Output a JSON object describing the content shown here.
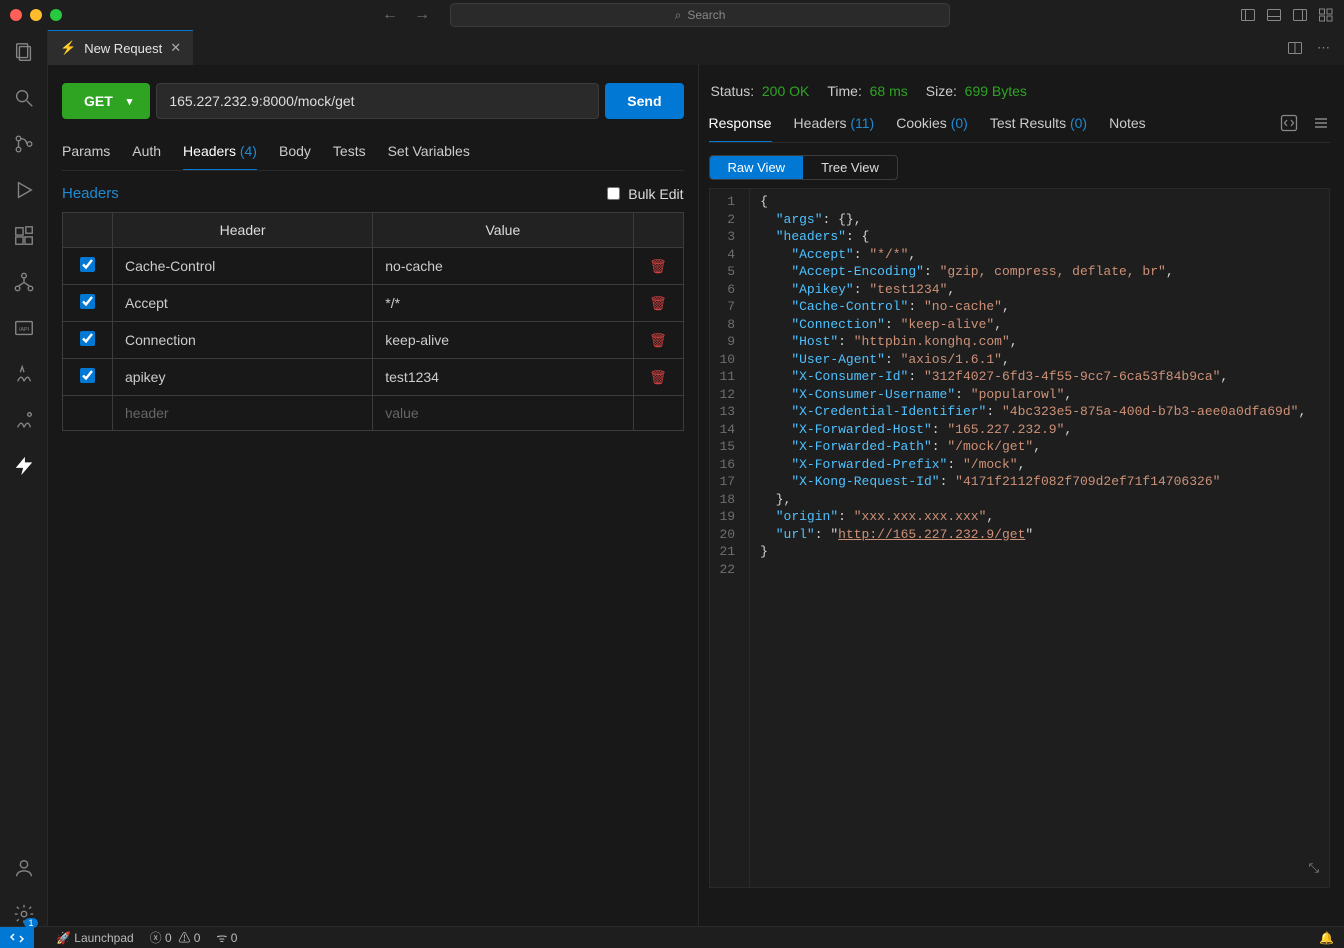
{
  "titlebar": {
    "search_placeholder": "Search"
  },
  "tab": {
    "title": "New Request"
  },
  "request": {
    "method": "GET",
    "url": "165.227.232.9:8000/mock/get",
    "send_label": "Send",
    "tabs": {
      "params": "Params",
      "auth": "Auth",
      "headers": "Headers",
      "headers_count": "(4)",
      "body": "Body",
      "tests": "Tests",
      "setvars": "Set Variables"
    },
    "section_title": "Headers",
    "bulk_label": "Bulk Edit",
    "table": {
      "col_header": "Header",
      "col_value": "Value",
      "rows": [
        {
          "checked": true,
          "header": "Cache-Control",
          "value": "no-cache"
        },
        {
          "checked": true,
          "header": "Accept",
          "value": "*/*"
        },
        {
          "checked": true,
          "header": "Connection",
          "value": "keep-alive"
        },
        {
          "checked": true,
          "header": "apikey",
          "value": "test1234"
        }
      ],
      "placeholder_header": "header",
      "placeholder_value": "value"
    }
  },
  "response": {
    "status_label": "Status:",
    "status_value": "200 OK",
    "time_label": "Time:",
    "time_value": "68 ms",
    "size_label": "Size:",
    "size_value": "699 Bytes",
    "tabs": {
      "response": "Response",
      "headers": "Headers",
      "headers_count": "(11)",
      "cookies": "Cookies",
      "cookies_count": "(0)",
      "tests": "Test Results",
      "tests_count": "(0)",
      "notes": "Notes"
    },
    "view_raw": "Raw View",
    "view_tree": "Tree View",
    "json_lines": [
      [
        {
          "t": "punc",
          "v": "{"
        }
      ],
      [
        {
          "t": "ind",
          "v": "  "
        },
        {
          "t": "key",
          "v": "\"args\""
        },
        {
          "t": "punc",
          "v": ": {},"
        }
      ],
      [
        {
          "t": "ind",
          "v": "  "
        },
        {
          "t": "key",
          "v": "\"headers\""
        },
        {
          "t": "punc",
          "v": ": {"
        }
      ],
      [
        {
          "t": "ind",
          "v": "    "
        },
        {
          "t": "key",
          "v": "\"Accept\""
        },
        {
          "t": "punc",
          "v": ": "
        },
        {
          "t": "str",
          "v": "\"*/*\""
        },
        {
          "t": "punc",
          "v": ","
        }
      ],
      [
        {
          "t": "ind",
          "v": "    "
        },
        {
          "t": "key",
          "v": "\"Accept-Encoding\""
        },
        {
          "t": "punc",
          "v": ": "
        },
        {
          "t": "str",
          "v": "\"gzip, compress, deflate, br\""
        },
        {
          "t": "punc",
          "v": ","
        }
      ],
      [
        {
          "t": "ind",
          "v": "    "
        },
        {
          "t": "key",
          "v": "\"Apikey\""
        },
        {
          "t": "punc",
          "v": ": "
        },
        {
          "t": "str",
          "v": "\"test1234\""
        },
        {
          "t": "punc",
          "v": ","
        }
      ],
      [
        {
          "t": "ind",
          "v": "    "
        },
        {
          "t": "key",
          "v": "\"Cache-Control\""
        },
        {
          "t": "punc",
          "v": ": "
        },
        {
          "t": "str",
          "v": "\"no-cache\""
        },
        {
          "t": "punc",
          "v": ","
        }
      ],
      [
        {
          "t": "ind",
          "v": "    "
        },
        {
          "t": "key",
          "v": "\"Connection\""
        },
        {
          "t": "punc",
          "v": ": "
        },
        {
          "t": "str",
          "v": "\"keep-alive\""
        },
        {
          "t": "punc",
          "v": ","
        }
      ],
      [
        {
          "t": "ind",
          "v": "    "
        },
        {
          "t": "key",
          "v": "\"Host\""
        },
        {
          "t": "punc",
          "v": ": "
        },
        {
          "t": "str",
          "v": "\"httpbin.konghq.com\""
        },
        {
          "t": "punc",
          "v": ","
        }
      ],
      [
        {
          "t": "ind",
          "v": "    "
        },
        {
          "t": "key",
          "v": "\"User-Agent\""
        },
        {
          "t": "punc",
          "v": ": "
        },
        {
          "t": "str",
          "v": "\"axios/1.6.1\""
        },
        {
          "t": "punc",
          "v": ","
        }
      ],
      [
        {
          "t": "ind",
          "v": "    "
        },
        {
          "t": "key",
          "v": "\"X-Consumer-Id\""
        },
        {
          "t": "punc",
          "v": ": "
        },
        {
          "t": "str",
          "v": "\"312f4027-6fd3-4f55-9cc7-6ca53f84b9ca\""
        },
        {
          "t": "punc",
          "v": ","
        }
      ],
      [
        {
          "t": "ind",
          "v": "    "
        },
        {
          "t": "key",
          "v": "\"X-Consumer-Username\""
        },
        {
          "t": "punc",
          "v": ": "
        },
        {
          "t": "str",
          "v": "\"popularowl\""
        },
        {
          "t": "punc",
          "v": ","
        }
      ],
      [
        {
          "t": "ind",
          "v": "    "
        },
        {
          "t": "key",
          "v": "\"X-Credential-Identifier\""
        },
        {
          "t": "punc",
          "v": ": "
        },
        {
          "t": "str",
          "v": "\"4bc323e5-875a-400d-b7b3-aee0a0dfa69d\""
        },
        {
          "t": "punc",
          "v": ","
        }
      ],
      [
        {
          "t": "ind",
          "v": "    "
        },
        {
          "t": "key",
          "v": "\"X-Forwarded-Host\""
        },
        {
          "t": "punc",
          "v": ": "
        },
        {
          "t": "str",
          "v": "\"165.227.232.9\""
        },
        {
          "t": "punc",
          "v": ","
        }
      ],
      [
        {
          "t": "ind",
          "v": "    "
        },
        {
          "t": "key",
          "v": "\"X-Forwarded-Path\""
        },
        {
          "t": "punc",
          "v": ": "
        },
        {
          "t": "str",
          "v": "\"/mock/get\""
        },
        {
          "t": "punc",
          "v": ","
        }
      ],
      [
        {
          "t": "ind",
          "v": "    "
        },
        {
          "t": "key",
          "v": "\"X-Forwarded-Prefix\""
        },
        {
          "t": "punc",
          "v": ": "
        },
        {
          "t": "str",
          "v": "\"/mock\""
        },
        {
          "t": "punc",
          "v": ","
        }
      ],
      [
        {
          "t": "ind",
          "v": "    "
        },
        {
          "t": "key",
          "v": "\"X-Kong-Request-Id\""
        },
        {
          "t": "punc",
          "v": ": "
        },
        {
          "t": "str",
          "v": "\"4171f2112f082f709d2ef71f14706326\""
        }
      ],
      [
        {
          "t": "ind",
          "v": "  "
        },
        {
          "t": "punc",
          "v": "},"
        }
      ],
      [
        {
          "t": "ind",
          "v": "  "
        },
        {
          "t": "key",
          "v": "\"origin\""
        },
        {
          "t": "punc",
          "v": ": "
        },
        {
          "t": "str",
          "v": "\"xxx.xxx.xxx.xxx\""
        },
        {
          "t": "punc",
          "v": ","
        }
      ],
      [
        {
          "t": "ind",
          "v": "  "
        },
        {
          "t": "key",
          "v": "\"url\""
        },
        {
          "t": "punc",
          "v": ": "
        },
        {
          "t": "punc",
          "v": "\""
        },
        {
          "t": "link",
          "v": "http://165.227.232.9/get"
        },
        {
          "t": "punc",
          "v": "\""
        }
      ],
      [
        {
          "t": "punc",
          "v": "}"
        }
      ],
      []
    ]
  },
  "statusbar": {
    "launchpad": "Launchpad",
    "errors": "0",
    "warnings": "0",
    "radio": "0"
  }
}
